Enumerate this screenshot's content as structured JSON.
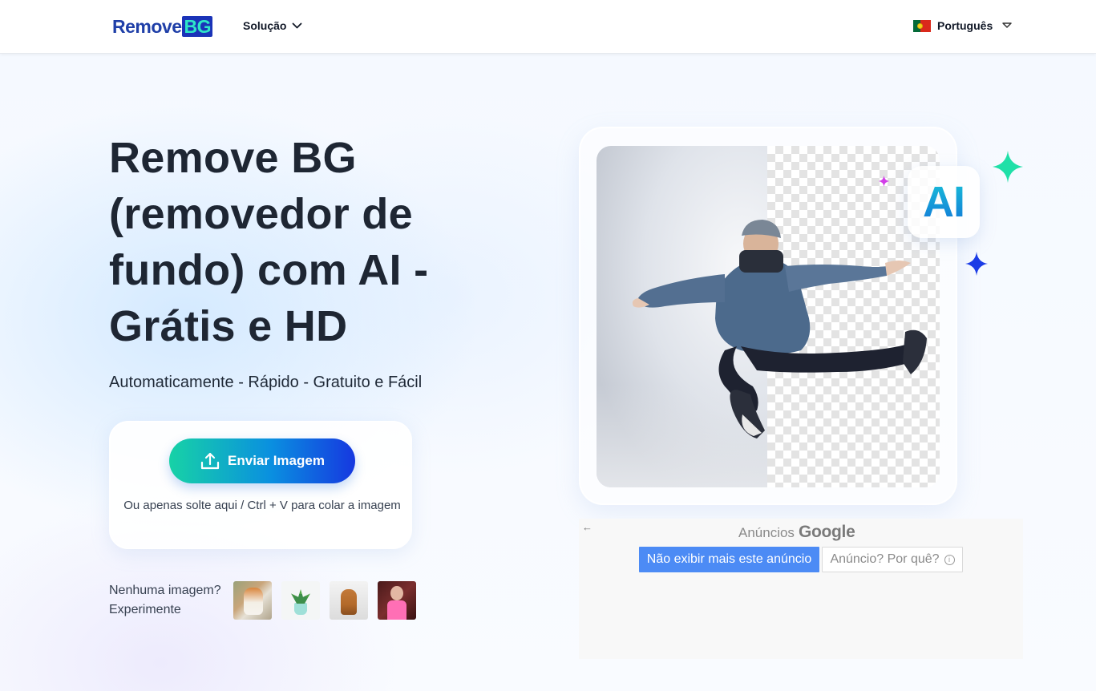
{
  "header": {
    "logo_part1": "Remove",
    "logo_part2": "BG",
    "nav_solucao": "Solução",
    "language": "Português",
    "flag_colors": {
      "green": "#046a38",
      "red": "#da291c",
      "emblem": "#f6d21c"
    }
  },
  "hero": {
    "title": "Remove BG (removedor de fundo) com AI - Grátis e HD",
    "subtitle": "Automaticamente - Rápido - Gratuito e Fácil",
    "upload_button": "Enviar Imagem",
    "drop_hint": "Ou apenas solte aqui / Ctrl + V para colar a imagem",
    "try_line1": "Nenhuma imagem?",
    "try_line2": "Experimente"
  },
  "samples": [
    {
      "icon": "cat-thumbnail"
    },
    {
      "icon": "plant-thumbnail"
    },
    {
      "icon": "dog-thumbnail"
    },
    {
      "icon": "woman-thumbnail"
    }
  ],
  "showcase": {
    "badge": "AI",
    "colors": {
      "spark_green": "#1fe0a8",
      "spark_blue": "#1b3ce6",
      "spark_pink": "#d23ee8"
    }
  },
  "ad": {
    "back_icon": "←",
    "label": "Anúncios",
    "brand": "Google",
    "primary_button": "Não exibir mais este anúncio",
    "secondary_button": "Anúncio? Por quê?",
    "info_icon": "ⓘ"
  },
  "colors": {
    "accent_blue": "#1638e0",
    "accent_teal": "#17d2a6",
    "ad_blue": "#4c8bf5",
    "title_text": "#1e2633"
  }
}
